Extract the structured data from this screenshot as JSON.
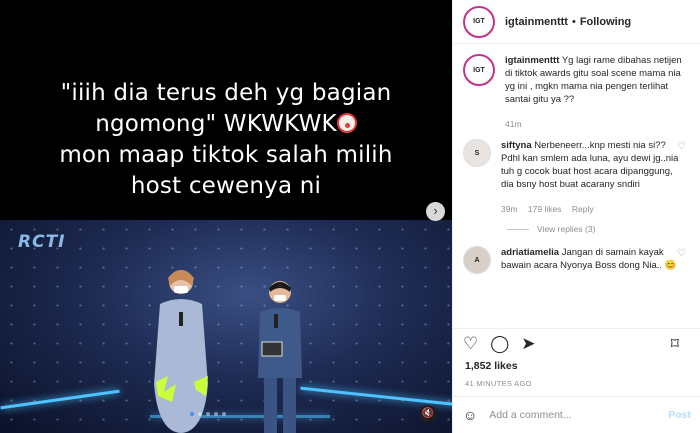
{
  "media": {
    "caption_lines": [
      "\"iiih dia terus deh yg bagian",
      "ngomong\" WKWKWK",
      "mon maap tiktok salah milih",
      "host cewenya ni"
    ],
    "tv_logo": "RCTI",
    "next_icon": "›",
    "mute_icon": "🔇"
  },
  "header": {
    "username": "igtainmenttt",
    "separator": "•",
    "follow_label": "Following"
  },
  "comments": [
    {
      "avatar_text": "IGT",
      "username": "igtainmenttt",
      "text": "Yg lagi rame dibahas netijen di tiktok awards gitu soal scene mama nia yg ini , mgkn mama nia pengen terlihat santai gitu ya ??",
      "time": "41m"
    },
    {
      "avatar_text": "S",
      "username": "siftyna",
      "text": "Nerbeneerr...knp mesti nia si?? Pdhl kan smlem ada luna, ayu dewi jg..nia tuh g cocok buat host acara dipanggung, dia bsny host buat acarany sndiri",
      "time": "39m",
      "likes": "179 likes",
      "reply": "Reply",
      "view_replies": "View replies (3)"
    },
    {
      "avatar_text": "A",
      "username": "adriatiamelia",
      "text": "Jangan di samain kayak bawain acara Nyonya Boss dong Nia.. 😊"
    }
  ],
  "footer": {
    "likes": "1,852 likes",
    "time_ago": "41 MINUTES AGO",
    "add_comment_placeholder": "Add a comment...",
    "post_label": "Post"
  },
  "colors": {
    "story_ring": "#c13584",
    "link_blue": "#b2dffc",
    "stage_glow": "#4ec3ff"
  }
}
